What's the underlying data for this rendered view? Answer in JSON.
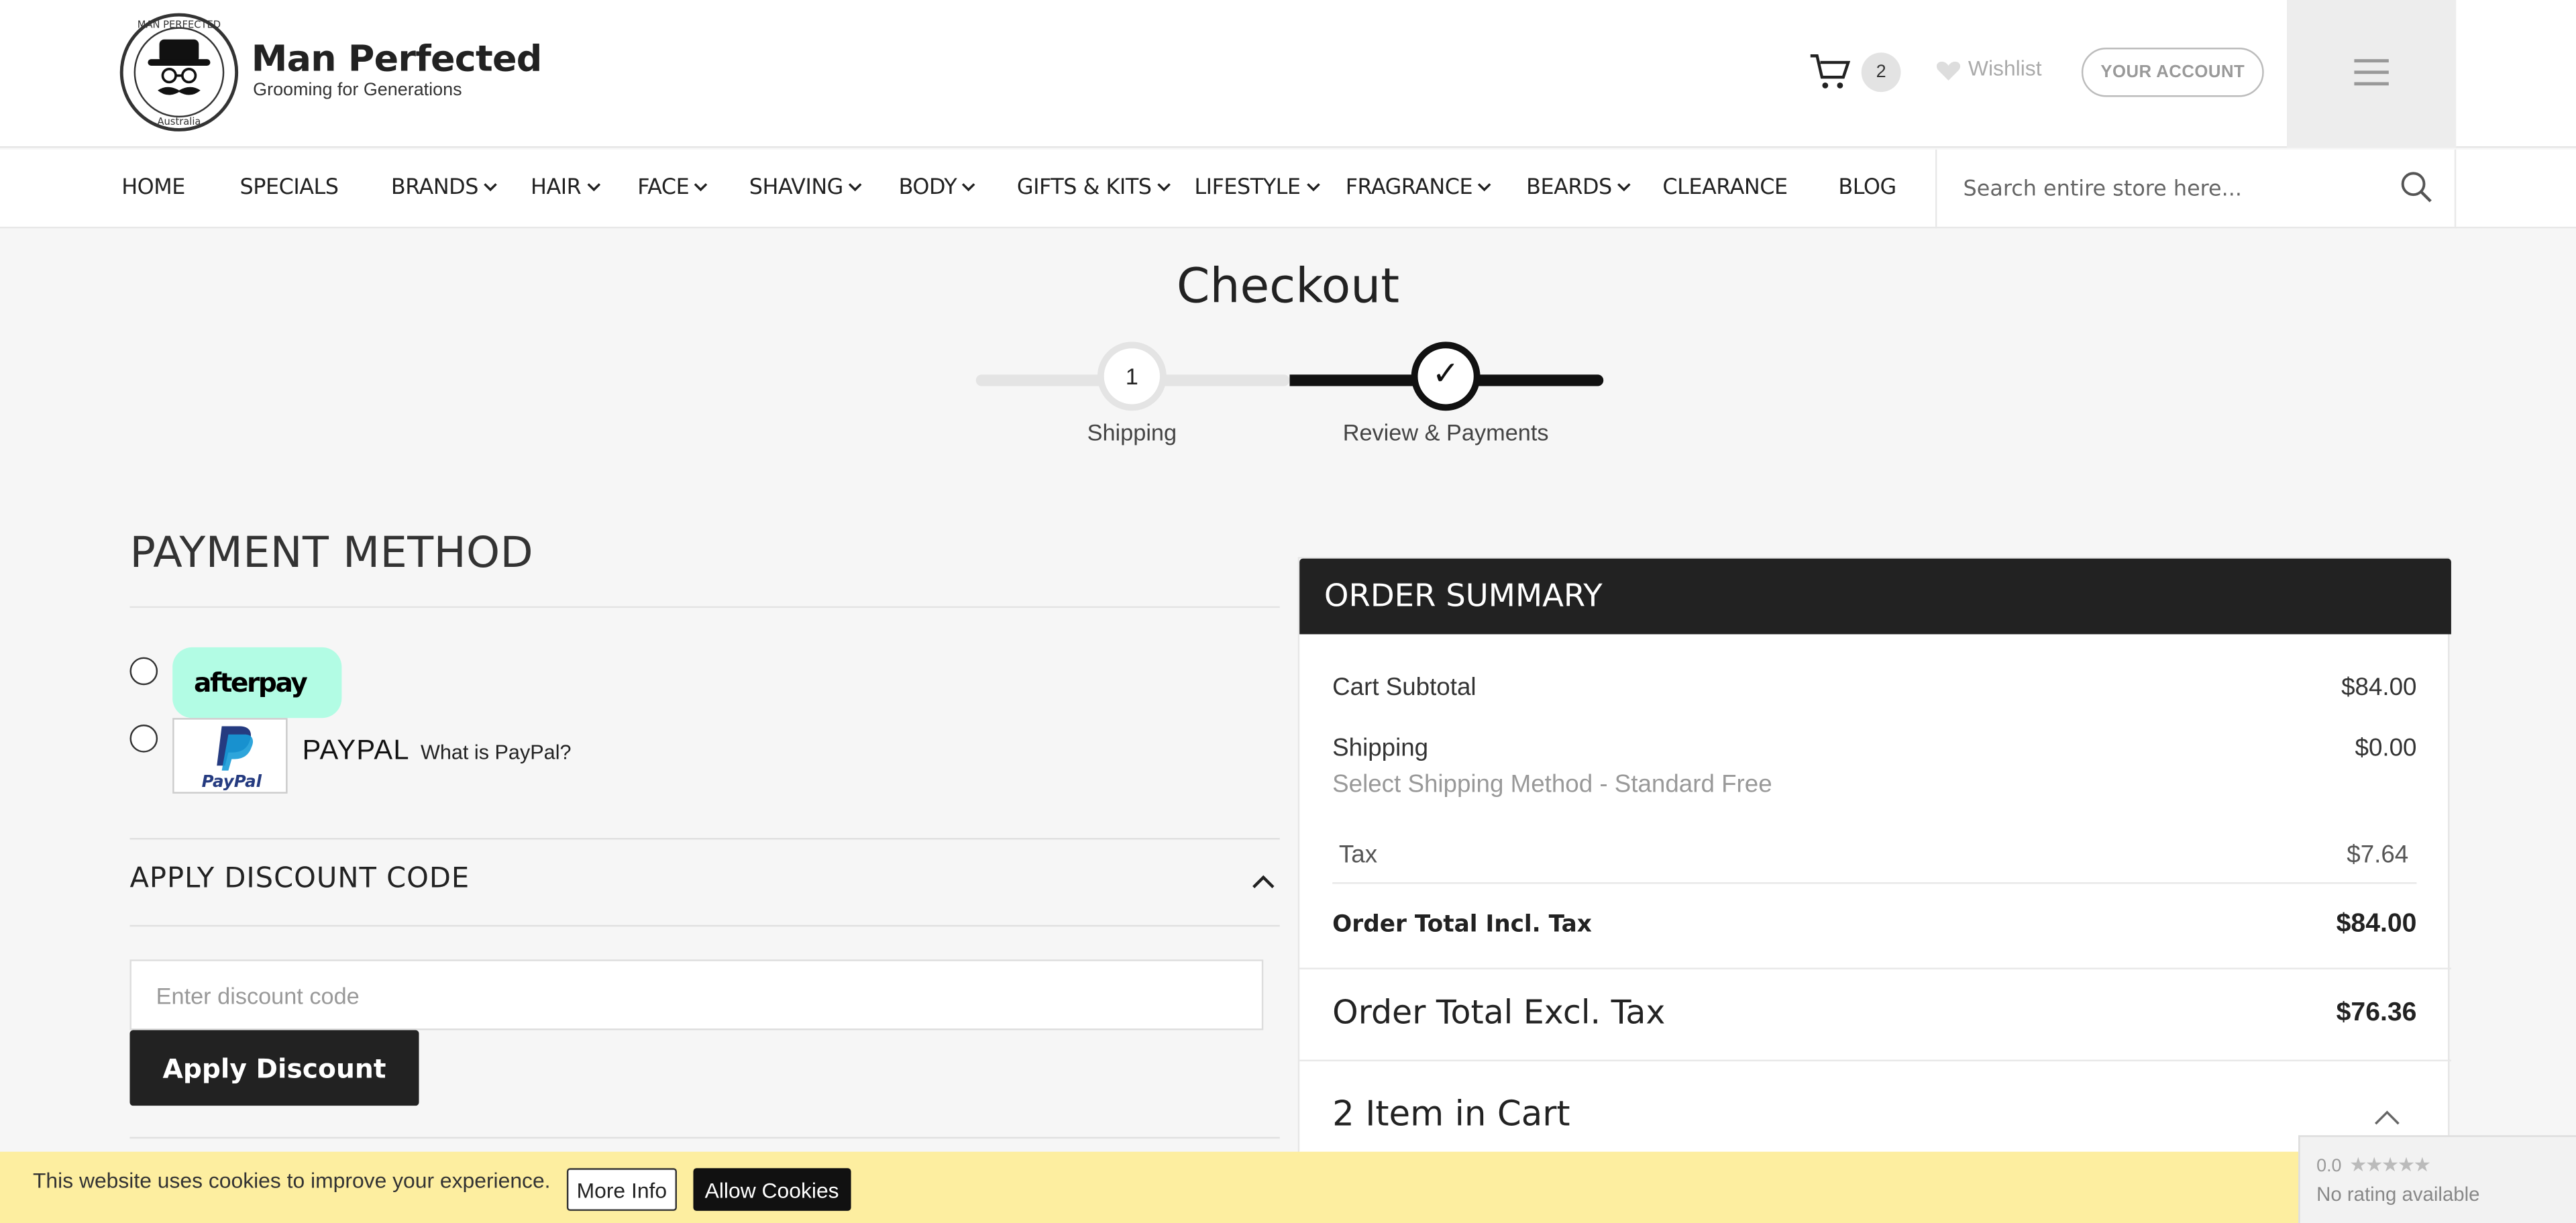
{
  "header": {
    "brand_name": "Man Perfected",
    "brand_tagline": "Grooming for Generations",
    "logo_ring_text": "MAN PERFECTED",
    "logo_bottom_text": "Australia",
    "cart_count": "2",
    "wishlist_label": "Wishlist",
    "account_label": "YOUR ACCOUNT"
  },
  "nav": {
    "items": [
      {
        "label": "HOME",
        "dropdown": false
      },
      {
        "label": "SPECIALS",
        "dropdown": false
      },
      {
        "label": "BRANDS",
        "dropdown": true
      },
      {
        "label": "HAIR",
        "dropdown": true
      },
      {
        "label": "FACE",
        "dropdown": true
      },
      {
        "label": "SHAVING",
        "dropdown": true
      },
      {
        "label": "BODY",
        "dropdown": true
      },
      {
        "label": "GIFTS & KITS",
        "dropdown": true
      },
      {
        "label": "LIFESTYLE",
        "dropdown": true
      },
      {
        "label": "FRAGRANCE",
        "dropdown": true
      },
      {
        "label": "BEARDS",
        "dropdown": true
      },
      {
        "label": "CLEARANCE",
        "dropdown": false
      },
      {
        "label": "BLOG",
        "dropdown": false
      }
    ],
    "search_placeholder": "Search entire store here..."
  },
  "checkout": {
    "title": "Checkout",
    "steps": [
      {
        "number": "1",
        "label": "Shipping",
        "state": "done"
      },
      {
        "label": "Review & Payments",
        "state": "active",
        "icon": "check-icon"
      }
    ]
  },
  "payment": {
    "title": "PAYMENT METHOD",
    "afterpay_label": "afterpay",
    "paypal_label": "PAYPAL",
    "paypal_logo_text": "PayPal",
    "paypal_link": "What is PayPal?"
  },
  "discount": {
    "title": "APPLY DISCOUNT CODE",
    "placeholder": "Enter discount code",
    "value": "",
    "button_label": "Apply Discount"
  },
  "summary": {
    "title": "ORDER SUMMARY",
    "subtotal_label": "Cart Subtotal",
    "subtotal_value": "$84.00",
    "shipping_label": "Shipping",
    "shipping_value": "$0.00",
    "shipping_method": "Select Shipping Method - Standard Free",
    "tax_label": "Tax",
    "tax_value": "$7.64",
    "total_incl_label": "Order Total Incl. Tax",
    "total_incl_value": "$84.00",
    "total_excl_label": "Order Total Excl. Tax",
    "total_excl_value": "$76.36",
    "items_in_cart": "2 Item in Cart"
  },
  "cookie": {
    "text": "This website uses cookies to improve your experience.",
    "more_info": "More Info",
    "allow": "Allow Cookies"
  },
  "rating": {
    "score": "0.0",
    "text": "No rating available"
  },
  "colors": {
    "dark": "#222222",
    "afterpay_mint": "#b2fce4",
    "cookie_bar": "#fdeea0",
    "paypal_blue": "#253b80"
  }
}
